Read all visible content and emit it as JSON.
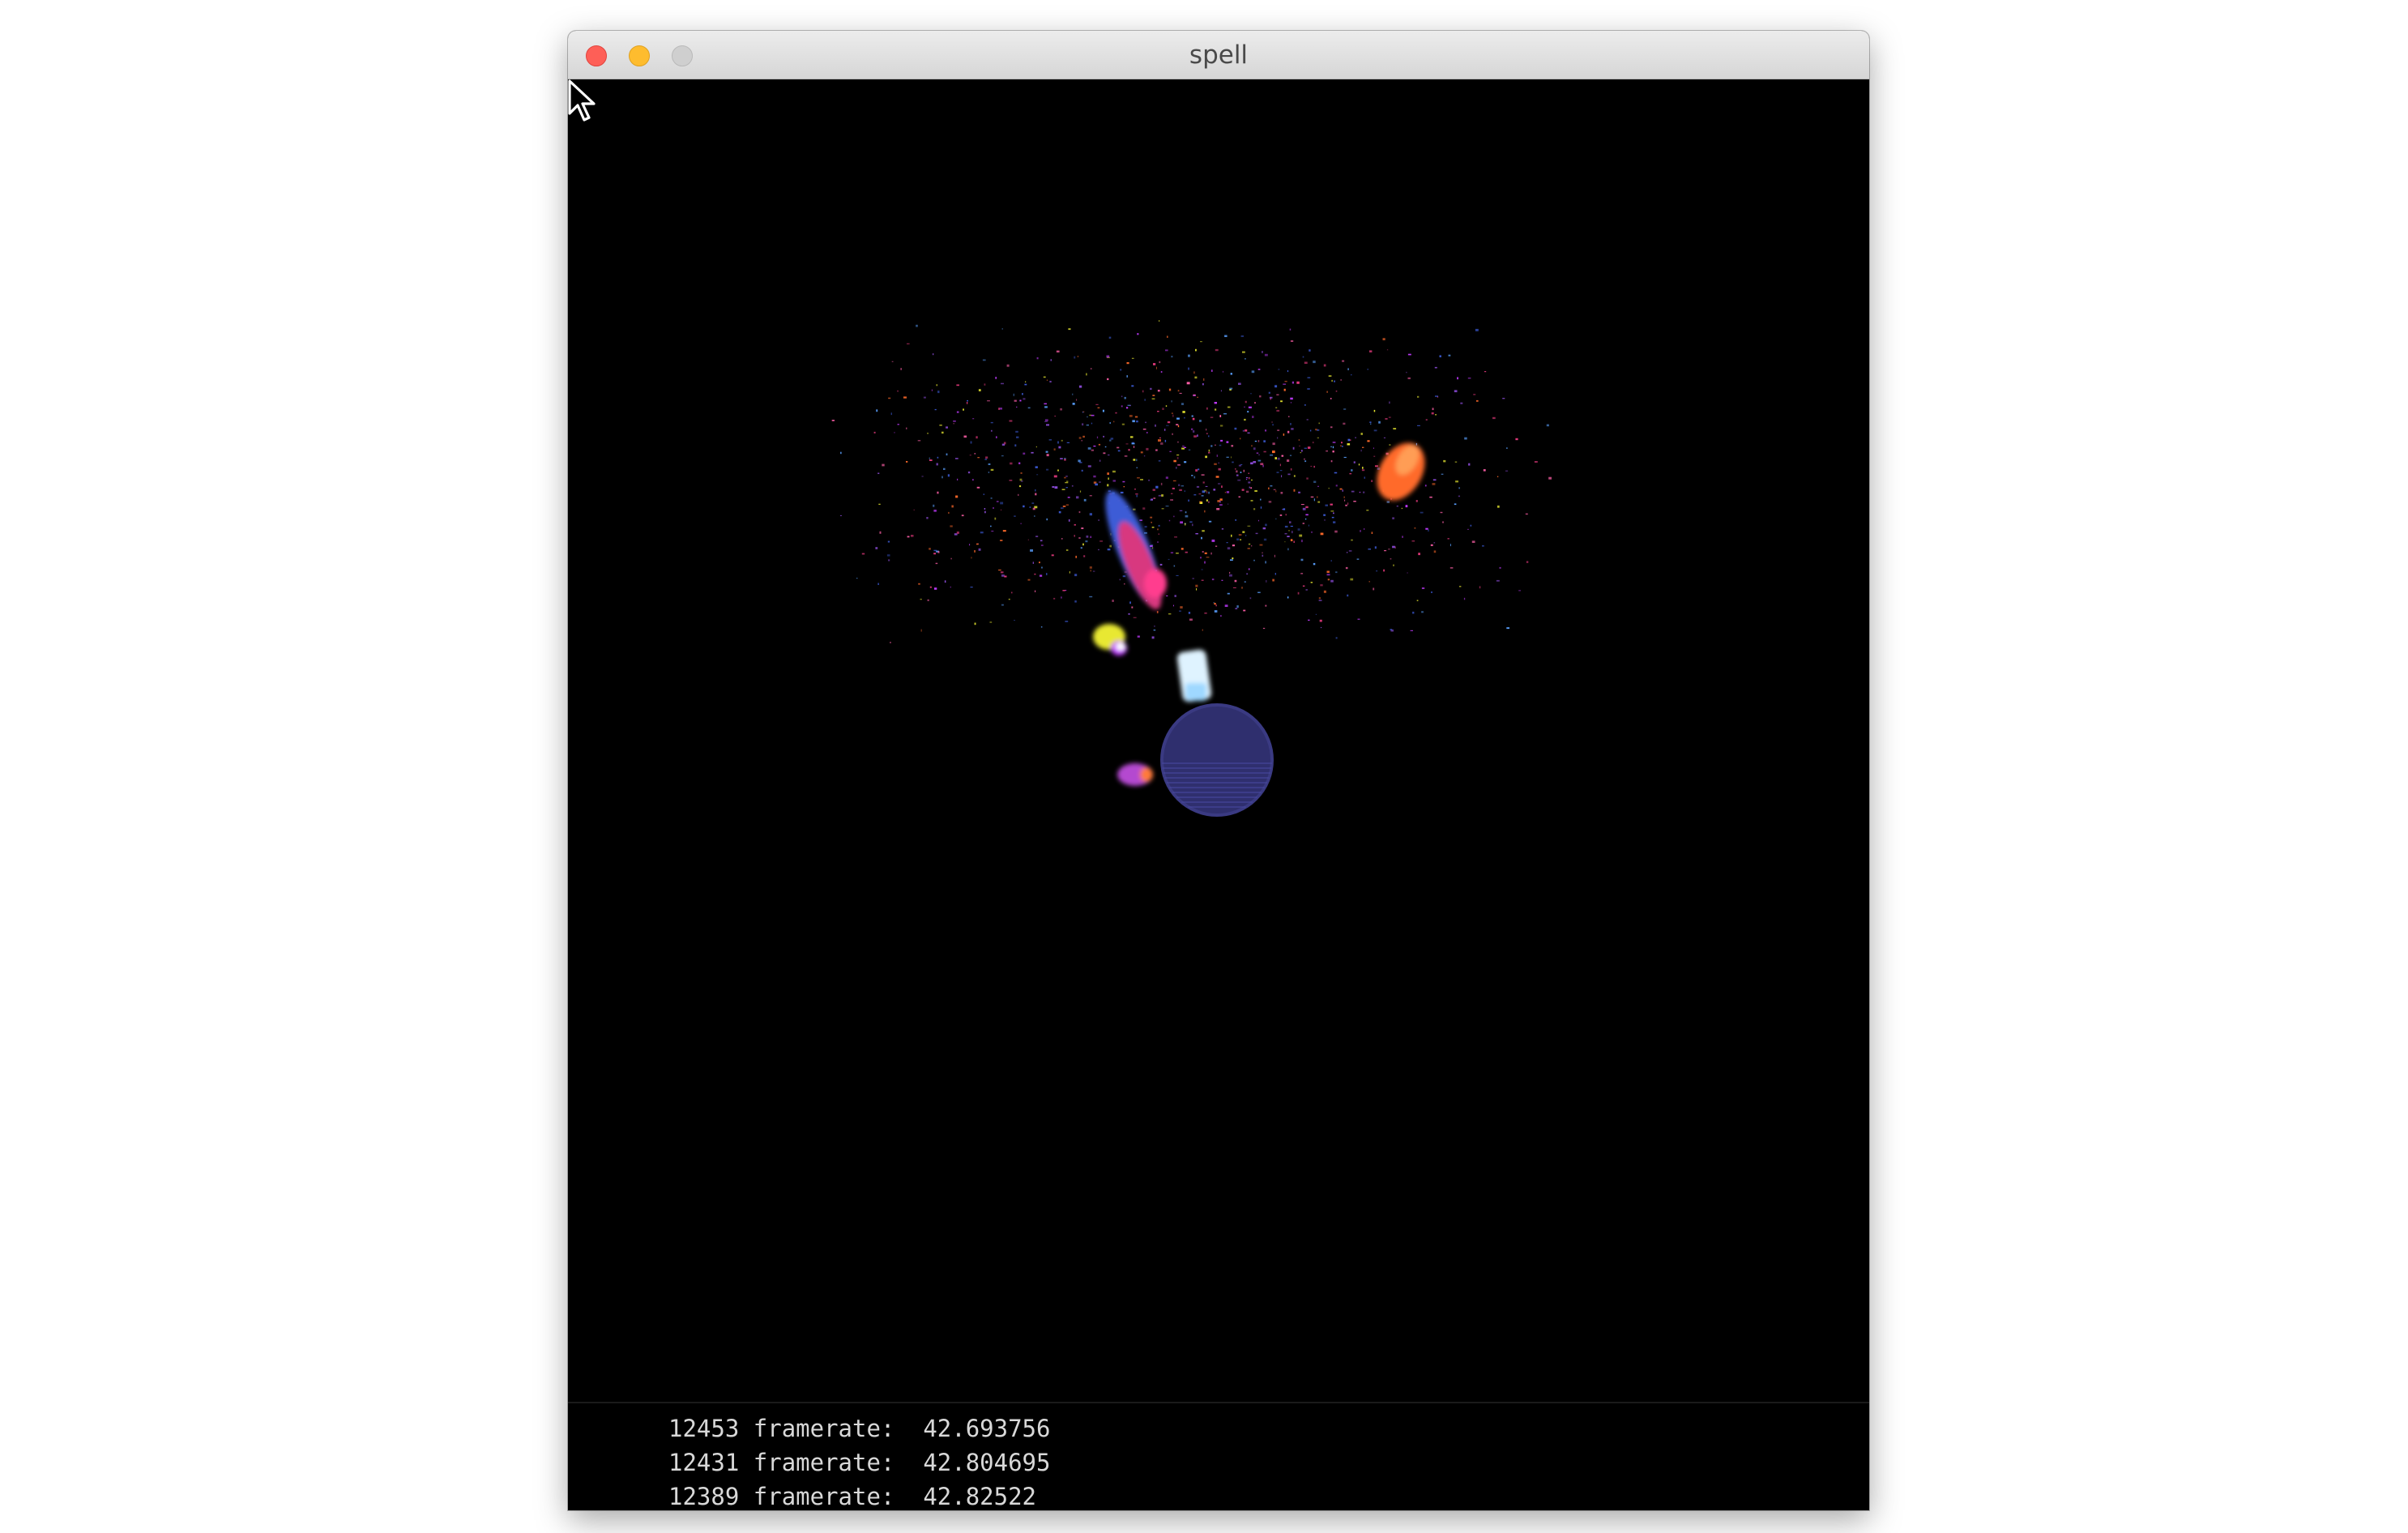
{
  "window": {
    "title": "spell"
  },
  "titlebar_buttons": {
    "close_icon": "close-icon",
    "minimize_icon": "minimize-icon",
    "maximize_icon": "maximize-icon"
  },
  "colors": {
    "planet": "#2f2f6e",
    "pink_trail": "#e0387a",
    "blue_trail": "#3c5bd6",
    "orange_burst": "#ff6a2a",
    "yellow_spark": "#e8e830",
    "white_jet": "#dff3ff"
  },
  "console": {
    "lines": [
      {
        "count": "12453",
        "label": "framerate:",
        "value": "42.693756"
      },
      {
        "count": "12431",
        "label": "framerate:",
        "value": "42.804695"
      },
      {
        "count": "12389",
        "label": "framerate:",
        "value": "42.82522"
      }
    ]
  }
}
